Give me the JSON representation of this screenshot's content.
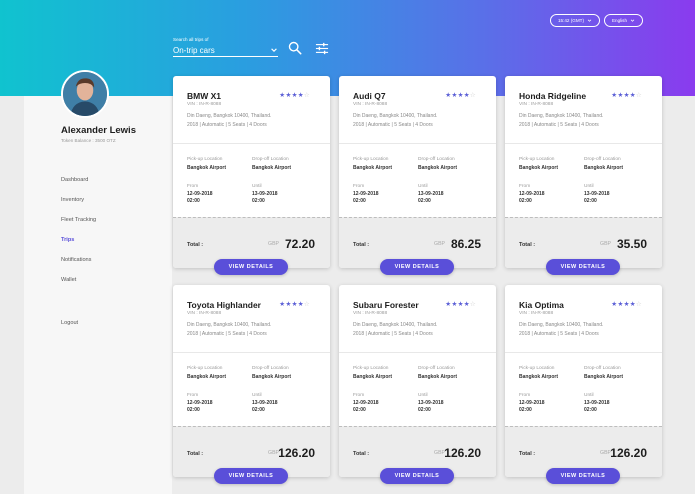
{
  "user": {
    "name": "Alexander Lewis",
    "token_balance": "Token Balance : 3500 OTZ"
  },
  "sidebar": {
    "items": [
      {
        "label": "Dashboard",
        "active": false
      },
      {
        "label": "Inventory",
        "active": false
      },
      {
        "label": "Fleet Tracking",
        "active": false
      },
      {
        "label": "Trips",
        "active": true
      },
      {
        "label": "Notifications",
        "active": false
      },
      {
        "label": "Wallet",
        "active": false
      }
    ],
    "logout": "Logout"
  },
  "search": {
    "label": "Search all trips of",
    "selected": "On-trip cars"
  },
  "header": {
    "time": "15:42 (GMT)",
    "language": "English"
  },
  "theme": {
    "accent": "#5a4fd9",
    "star_color": "#5b5fd6"
  },
  "cards": [
    {
      "title": "BMW X1",
      "rating": 4,
      "vin": "VIN : IN-R-8088",
      "address": "Din Daeng, Bangkok 10400, Thailand.",
      "specs": "2018  |  Automatic  |  5 Seats  |  4 Doors",
      "pickup_label": "Pick-up Location",
      "pickup": "Bangkok Airport",
      "dropoff_label": "Drop-off Location",
      "dropoff": "Bangkok Airport",
      "from_label": "From",
      "from_date": "12-09-2018",
      "from_time": "02:00",
      "until_label": "Until",
      "until_date": "13-09-2018",
      "until_time": "02:00",
      "total_label": "Total :",
      "currency": "GBP",
      "amount": "72.20",
      "button": "VIEW DETAILS"
    },
    {
      "title": "Audi Q7",
      "rating": 4,
      "vin": "VIN : IN-R-8088",
      "address": "Din Daeng, Bangkok 10400, Thailand.",
      "specs": "2018  |  Automatic  |  5 Seats  |  4 Doors",
      "pickup_label": "Pick-up Location",
      "pickup": "Bangkok Airport",
      "dropoff_label": "Drop-off Location",
      "dropoff": "Bangkok Airport",
      "from_label": "From",
      "from_date": "12-09-2018",
      "from_time": "02:00",
      "until_label": "Until",
      "until_date": "13-09-2018",
      "until_time": "02:00",
      "total_label": "Total :",
      "currency": "GBP",
      "amount": "86.25",
      "button": "VIEW DETAILS"
    },
    {
      "title": "Honda Ridgeline",
      "rating": 4,
      "vin": "VIN : IN-R-8088",
      "address": "Din Daeng, Bangkok 10400, Thailand.",
      "specs": "2018  |  Automatic  |  5 Seats  |  4 Doors",
      "pickup_label": "Pick-up Location",
      "pickup": "Bangkok Airport",
      "dropoff_label": "Drop-off Location",
      "dropoff": "Bangkok Airport",
      "from_label": "From",
      "from_date": "12-09-2018",
      "from_time": "02:00",
      "until_label": "Until",
      "until_date": "13-09-2018",
      "until_time": "02:00",
      "total_label": "Total :",
      "currency": "GBP",
      "amount": "35.50",
      "button": "VIEW DETAILS"
    },
    {
      "title": "Toyota Highlander",
      "rating": 4,
      "vin": "VIN : IN-R-8088",
      "address": "Din Daeng, Bangkok 10400, Thailand.",
      "specs": "2018  |  Automatic  |  5 Seats  |  4 Doors",
      "pickup_label": "Pick-up Location",
      "pickup": "Bangkok Airport",
      "dropoff_label": "Drop-off Location",
      "dropoff": "Bangkok Airport",
      "from_label": "From",
      "from_date": "12-09-2018",
      "from_time": "02:00",
      "until_label": "Until",
      "until_date": "13-09-2018",
      "until_time": "02:00",
      "total_label": "Total :",
      "currency": "GBP",
      "amount": "126.20",
      "button": "VIEW DETAILS"
    },
    {
      "title": "Subaru Forester",
      "rating": 4,
      "vin": "VIN : IN-R-8088",
      "address": "Din Daeng, Bangkok 10400, Thailand.",
      "specs": "2018  |  Automatic  |  5 Seats  |  4 Doors",
      "pickup_label": "Pick-up Location",
      "pickup": "Bangkok Airport",
      "dropoff_label": "Drop-off Location",
      "dropoff": "Bangkok Airport",
      "from_label": "From",
      "from_date": "12-09-2018",
      "from_time": "02:00",
      "until_label": "Until",
      "until_date": "13-09-2018",
      "until_time": "02:00",
      "total_label": "Total :",
      "currency": "GBP",
      "amount": "126.20",
      "button": "VIEW DETAILS"
    },
    {
      "title": "Kia Optima",
      "rating": 4,
      "vin": "VIN : IN-R-8088",
      "address": "Din Daeng, Bangkok 10400, Thailand.",
      "specs": "2018  |  Automatic  |  5 Seats  |  4 Doors",
      "pickup_label": "Pick-up Location",
      "pickup": "Bangkok Airport",
      "dropoff_label": "Drop-off Location",
      "dropoff": "Bangkok Airport",
      "from_label": "From",
      "from_date": "12-09-2018",
      "from_time": "02:00",
      "until_label": "Until",
      "until_date": "13-09-2018",
      "until_time": "02:00",
      "total_label": "Total :",
      "currency": "GBP",
      "amount": "126.20",
      "button": "VIEW DETAILS"
    }
  ]
}
